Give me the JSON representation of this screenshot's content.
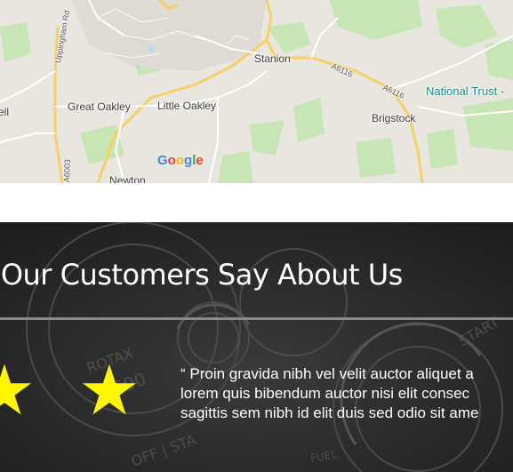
{
  "map": {
    "labels": {
      "uppingham_rd": "Uppingham Rd",
      "stanion": "Stanion",
      "a6116_a": "A6116",
      "a6116_b": "A6116",
      "national_trust": "National Trust -",
      "brigstock": "Brigstock",
      "great_oakley": "Great Oakley",
      "little_oakley": "Little Oakley",
      "ell": "ell",
      "a6003": "A6003",
      "newton": "Newton"
    },
    "logo": [
      "G",
      "o",
      "o",
      "g",
      "l",
      "e"
    ]
  },
  "testimonials": {
    "title": "at Our Customers Say About Us",
    "rating_stars": 2,
    "star_glyph": "★",
    "quote_lines": [
      "“ Proin gravida nibh vel velit auctor aliquet a",
      "lorem quis bibendum auctor nisi elit consec",
      "sagittis sem nibh id elit duis sed odio sit ame"
    ],
    "colors": {
      "star": "#fff600",
      "background": "#2a2a2a",
      "divider": "#8a8a8a"
    }
  }
}
